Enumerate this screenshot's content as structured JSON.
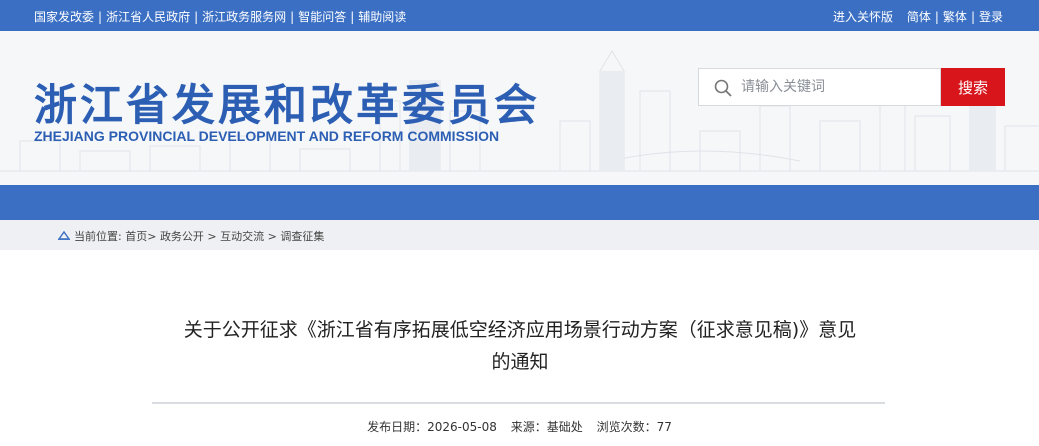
{
  "topbar": {
    "links": [
      "国家发改委",
      "浙江省人民政府",
      "浙江政务服务网",
      "智能问答",
      "辅助阅读"
    ],
    "right_links": [
      "进入关怀版",
      "简体",
      "繁体",
      "登录"
    ]
  },
  "header": {
    "title": "浙江省发展和改革委员会",
    "subtitle": "ZHEJIANG PROVINCIAL DEVELOPMENT AND REFORM COMMISSION",
    "search_placeholder": "请输入关键词",
    "search_button": "搜索"
  },
  "breadcrumb": {
    "prefix": "当前位置:",
    "items": [
      "首页",
      "政务公开",
      "互动交流",
      "调查征集"
    ]
  },
  "article": {
    "title_line1": "关于公开征求《浙江省有序拓展低空经济应用场景行动方案（征求意见稿)》意见",
    "title_line2": "的通知",
    "publish_date_label": "发布日期：2026-05-08",
    "source_label": "来源：基础处",
    "views_label": "浏览次数：77"
  },
  "colors": {
    "brand_blue": "#3a6fc4",
    "title_blue": "#2c5fb3",
    "search_red": "#d7151b"
  }
}
